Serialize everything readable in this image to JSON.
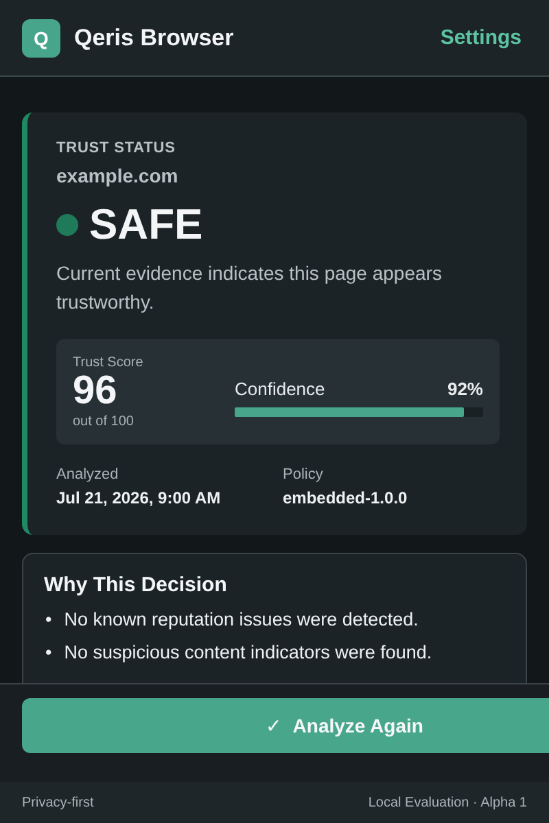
{
  "header": {
    "logo_letter": "Q",
    "title": "Qeris Browser",
    "settings_link": "Settings"
  },
  "status_card": {
    "eyebrow": "TRUST STATUS",
    "domain": "example.com",
    "verdict": {
      "label": "SAFE",
      "color": "#1f7a5a"
    },
    "summary": "Current evidence indicates this page appears trustworthy.",
    "score": {
      "label": "Trust Score",
      "value": "96",
      "scale": "out of 100"
    },
    "confidence": {
      "label": "Confidence",
      "reading": "92%",
      "level": 0.92
    },
    "meta": [
      {
        "label": "Analyzed",
        "value": "Jul 21, 2026, 9:00 AM"
      },
      {
        "label": "Policy",
        "value": "embedded-1.0.0"
      }
    ]
  },
  "reasons": {
    "title": "Why This Decision",
    "items": [
      {
        "marker": "•",
        "text": "No known reputation issues were detected."
      },
      {
        "marker": "•",
        "text": "No suspicious content indicators were found."
      }
    ]
  },
  "action_button": {
    "icon": "✓",
    "label": "Analyze Again"
  },
  "footer": {
    "left": "Privacy-first",
    "right": "Local Evaluation · Alpha 1"
  }
}
